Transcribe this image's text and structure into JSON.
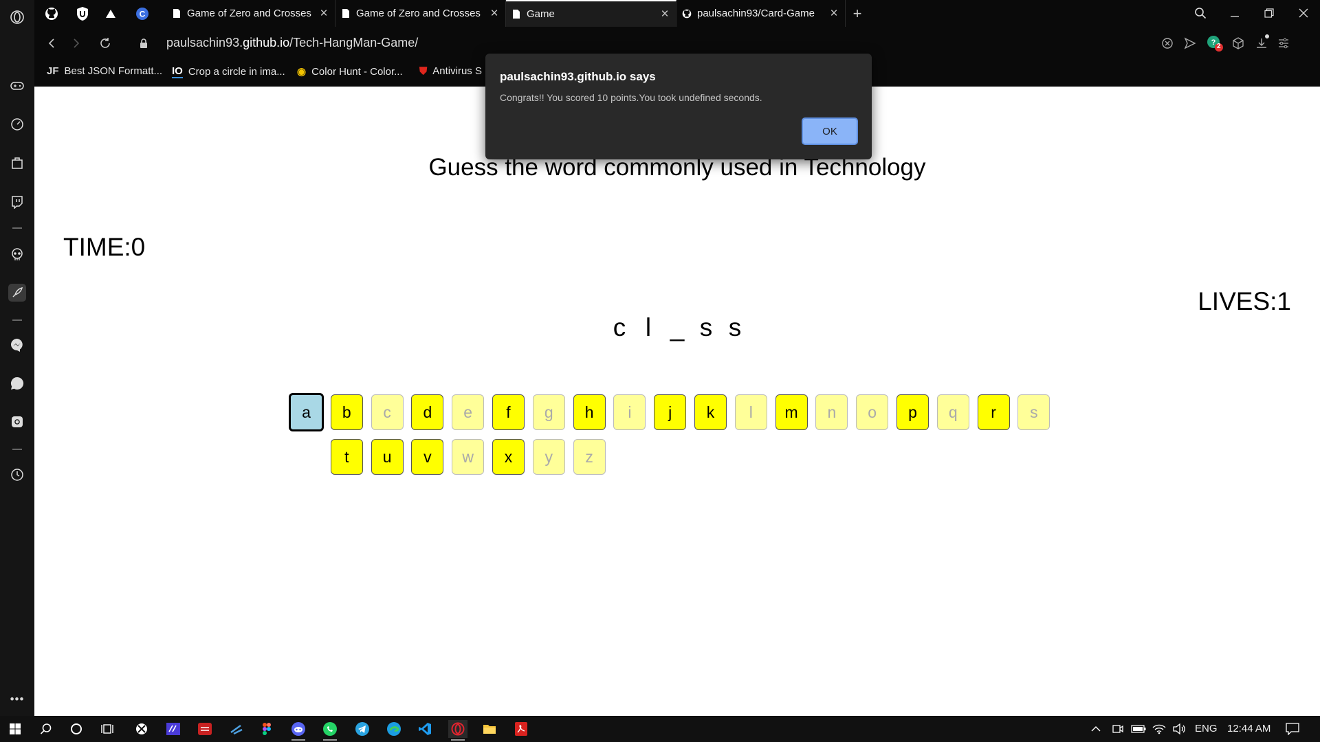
{
  "browser": {
    "sidebar_icons": [
      "opera-logo-icon",
      "gamepad-icon",
      "speed-dial-icon",
      "shopping-bag-icon",
      "twitch-icon",
      "skull-icon",
      "rocket-icon",
      "messenger-icon",
      "whatsapp-icon",
      "instagram-icon",
      "history-icon",
      "more-icon"
    ],
    "tabs": [
      {
        "title": "Game of Zero and Crosses",
        "active": false
      },
      {
        "title": "Game of Zero and Crosses",
        "active": false
      },
      {
        "title": "Game",
        "active": true
      },
      {
        "title": "paulsachin93/Card-Game",
        "active": false
      }
    ],
    "new_tab_label": "+",
    "url": {
      "prefix": "paulsachin93.",
      "domain": "github.io",
      "path": "/Tech-HangMan-Game/"
    },
    "bookmarks": [
      {
        "icon_text": "JF",
        "label": "Best JSON Formatt..."
      },
      {
        "icon_text": "IO",
        "label": "Crop a circle in ima..."
      },
      {
        "icon_text": "◉",
        "label": "Color Hunt - Color..."
      },
      {
        "icon_text": "⛊",
        "label": "Antivirus S"
      }
    ],
    "extension_badge": "2"
  },
  "game": {
    "heading": "Guess the word commonly used in Technology",
    "time_label": "TIME:0",
    "lives_label": "LIVES:1",
    "word_letters": [
      "c",
      "l",
      "_",
      "s",
      "s"
    ],
    "keys": [
      {
        "letter": "a",
        "state": "selected"
      },
      {
        "letter": "b",
        "state": "available"
      },
      {
        "letter": "c",
        "state": "used"
      },
      {
        "letter": "d",
        "state": "available"
      },
      {
        "letter": "e",
        "state": "used"
      },
      {
        "letter": "f",
        "state": "available"
      },
      {
        "letter": "g",
        "state": "used"
      },
      {
        "letter": "h",
        "state": "available"
      },
      {
        "letter": "i",
        "state": "used"
      },
      {
        "letter": "j",
        "state": "available"
      },
      {
        "letter": "k",
        "state": "available"
      },
      {
        "letter": "l",
        "state": "used"
      },
      {
        "letter": "m",
        "state": "available"
      },
      {
        "letter": "n",
        "state": "used"
      },
      {
        "letter": "o",
        "state": "used"
      },
      {
        "letter": "p",
        "state": "available"
      },
      {
        "letter": "q",
        "state": "used"
      },
      {
        "letter": "r",
        "state": "available"
      },
      {
        "letter": "s",
        "state": "used"
      },
      {
        "letter": "t",
        "state": "available"
      },
      {
        "letter": "u",
        "state": "available"
      },
      {
        "letter": "v",
        "state": "available"
      },
      {
        "letter": "w",
        "state": "used"
      },
      {
        "letter": "x",
        "state": "available"
      },
      {
        "letter": "y",
        "state": "used"
      },
      {
        "letter": "z",
        "state": "used"
      }
    ]
  },
  "dialog": {
    "title": "paulsachin93.github.io says",
    "message": "Congrats!! You scored 10 points.You took undefined seconds.",
    "ok_label": "OK"
  },
  "taskbar": {
    "language": "ENG",
    "time": "12:44 AM"
  },
  "colors": {
    "key_available": "#ffff00",
    "key_used": "#ffff99",
    "key_selected": "#a9d8e6",
    "dialog_button": "#8ab4f8"
  }
}
